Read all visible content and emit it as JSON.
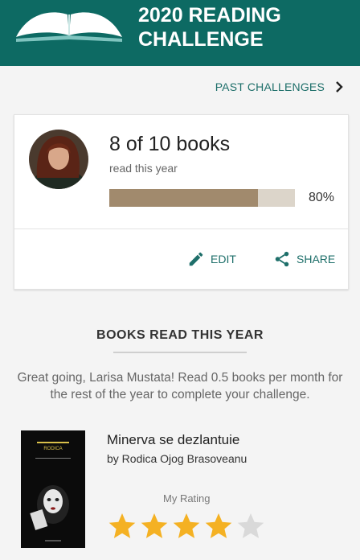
{
  "header": {
    "title": "2020 READING CHALLENGE"
  },
  "nav": {
    "past_challenges": "PAST CHALLENGES"
  },
  "progress": {
    "count_text": "8 of 10 books",
    "subtitle": "read this year",
    "percent_text": "80%",
    "fraction": 0.8,
    "edit_label": "EDIT",
    "share_label": "SHARE"
  },
  "books_section": {
    "title": "BOOKS READ THIS YEAR",
    "message": "Great going, Larisa Mustata! Read 0.5 books per month for the rest of the year to complete your challenge."
  },
  "book": {
    "title": "Minerva se dezlantuie",
    "author": "by Rodica Ojog Brasoveanu",
    "rating_label": "My Rating",
    "rating": 4,
    "max_rating": 5,
    "cover_text": "RODICA OJOG-BRASOVEANU"
  },
  "colors": {
    "header_bg": "#0d6a63",
    "accent": "#1e6f6a",
    "progress_fill": "#a18a6d",
    "star_filled": "#f4b123",
    "star_empty": "#d9d9d9"
  }
}
